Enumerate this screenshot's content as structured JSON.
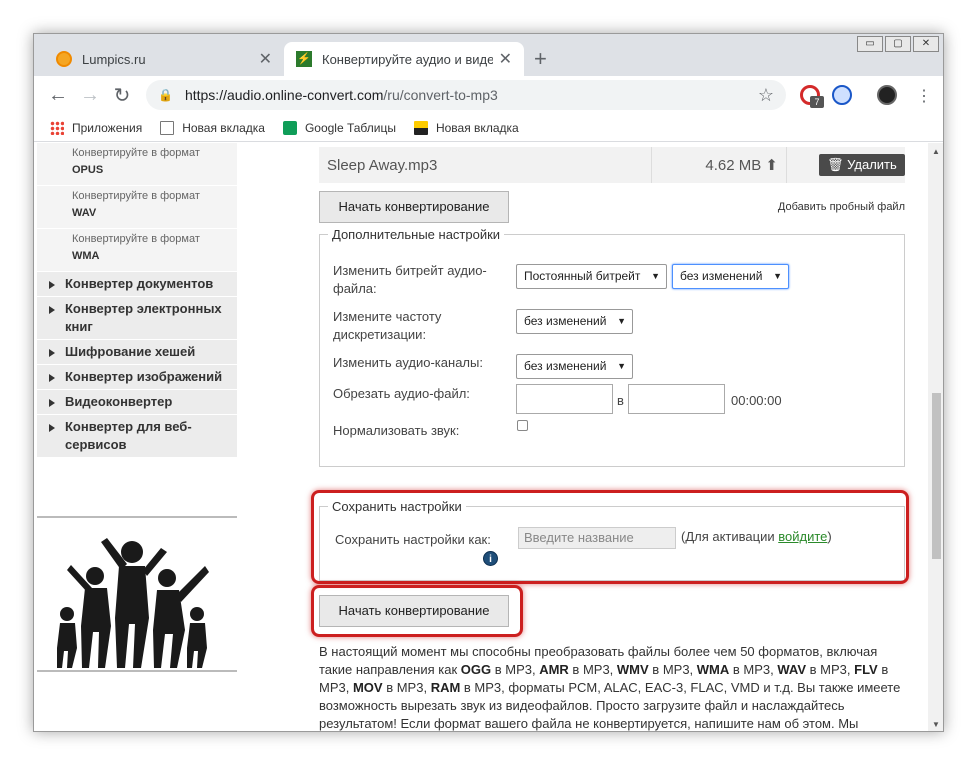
{
  "tabs": [
    {
      "title": "Lumpics.ru",
      "close": "✕"
    },
    {
      "title": "Конвертируйте аудио и видео в",
      "close": "✕"
    }
  ],
  "window_controls": [
    "▭",
    "▢",
    "✕"
  ],
  "toolbar": {
    "url_domain": "https://audio.online-convert.com",
    "url_path": "/ru/convert-to-mp3",
    "extension_badge": "7"
  },
  "bookmarks": [
    {
      "label": "Приложения",
      "icon": "apps-icon"
    },
    {
      "label": "Новая вкладка",
      "icon": "page-icon"
    },
    {
      "label": "Google Таблицы",
      "icon": "sheets-icon"
    },
    {
      "label": "Новая вкладка",
      "icon": "image-icon"
    }
  ],
  "sidebar": {
    "subitems": [
      {
        "prefix": "Конвертируйте в формат",
        "format": "OPUS"
      },
      {
        "prefix": "Конвертируйте в формат",
        "format": "WAV"
      },
      {
        "prefix": "Конвертируйте в формат",
        "format": "WMA"
      }
    ],
    "categories": [
      "Конвертер документов",
      "Конвертер электронных книг",
      "Шифрование хешей",
      "Конвертер изображений",
      "Видеоконвертер",
      "Конвертер для веб-сервисов"
    ]
  },
  "file": {
    "name": "Sleep Away.mp3",
    "size": "4.62 MB",
    "delete_label": "Удалить"
  },
  "start_button_label": "Начать конвертирование",
  "add_sample_label": "Добавить пробный файл",
  "advanced": {
    "legend": "Дополнительные настройки",
    "bitrate_label": "Изменить битрейт аудио-файла:",
    "bitrate_mode": "Постоянный битрейт",
    "bitrate_value": "без изменений",
    "samplerate_label": "Измените частоту дискретизации:",
    "samplerate_value": "без изменений",
    "channels_label": "Изменить аудио-каналы:",
    "channels_value": "без изменений",
    "trim_label": "Обрезать аудио-файл:",
    "trim_sep": "в",
    "trim_end": "00:00:00",
    "normalize_label": "Нормализовать звук:",
    "normalize_checked": false
  },
  "save_settings": {
    "legend": "Сохранить настройки",
    "label": "Сохранить настройки как:",
    "placeholder": "Введите название",
    "activation_prefix": "(Для активации ",
    "activation_link": "войдите",
    "activation_suffix": ")"
  },
  "highlight_color": "#cc1f1f",
  "description": {
    "p1": "В настоящий момент мы способны преобразовать файлы более чем 50 форматов, включая такие направления как ",
    "ogg": "OGG",
    "to_mp3_1": " в MP3, ",
    "amr": "AMR",
    "to_mp3_2": " в MP3, ",
    "wmv": "WMV",
    "to_mp3_3": " в MP3, ",
    "wma": "WMA",
    "to_mp3_4": " в MP3, ",
    "wav": "WAV",
    "to_mp3_5": " в MP3, ",
    "flv": "FLV",
    "to_mp3_6": " в MP3, ",
    "mov": "MOV",
    "to_mp3_7": " в MP3, ",
    "ram": "RAM",
    "rest": " в MP3, форматы PCM, ALAC, EAC-3, FLAC, VMD и т.д. Вы также имеете возможность вырезать звук из видеофайлов. Просто загрузите файл и наслаждайтесь результатом! Если формат вашего файла не конвертируется, напишите нам об этом. Мы добавим аудиоконвертер, необходимый именно вам."
  }
}
